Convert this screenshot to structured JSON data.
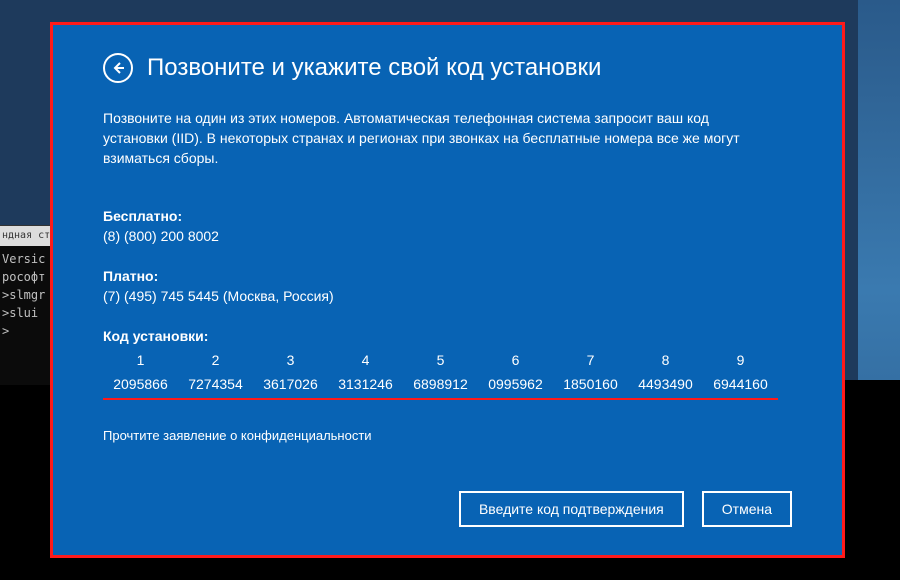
{
  "terminal": {
    "title": "ндная ст",
    "lines": [
      "Versic",
      "рософт",
      "",
      ">slmgr",
      "",
      ">slui",
      "",
      ">"
    ]
  },
  "header": {
    "title": "Позвоните и укажите свой код установки"
  },
  "instruction": "Позвоните на один из этих номеров. Автоматическая телефонная система запросит ваш код установки (IID). В некоторых странах и регионах при звонках на бесплатные номера все же могут взиматься сборы.",
  "free": {
    "label": "Бесплатно:",
    "value": "(8) (800) 200 8002"
  },
  "paid": {
    "label": "Платно:",
    "value": "(7) (495) 745 5445 (Москва, Россия)"
  },
  "install_code": {
    "label": "Код установки:",
    "columns": [
      "1",
      "2",
      "3",
      "4",
      "5",
      "6",
      "7",
      "8",
      "9"
    ],
    "values": [
      "2095866",
      "7274354",
      "3617026",
      "3131246",
      "6898912",
      "0995962",
      "1850160",
      "4493490",
      "6944160"
    ]
  },
  "privacy_link": "Прочтите заявление о конфиденциальности",
  "buttons": {
    "confirm": "Введите код подтверждения",
    "cancel": "Отмена"
  }
}
